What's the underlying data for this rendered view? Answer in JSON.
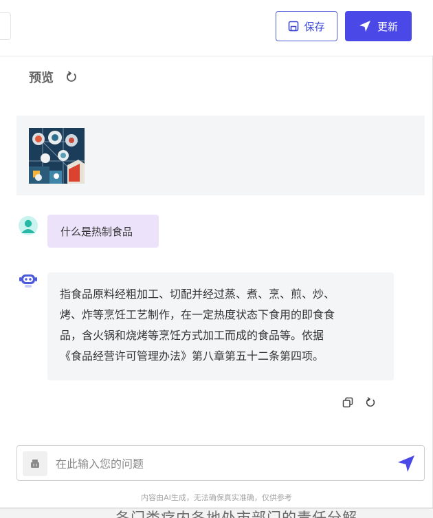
{
  "header": {
    "save_label": "保存",
    "update_label": "更新"
  },
  "preview": {
    "title": "预览"
  },
  "conversation": {
    "user_message": "什么是热制食品",
    "bot_lines": [
      "指食品原料经粗加工、切配并经过蒸、煮、烹、煎、炒、",
      "烤、炸等烹饪工艺制作，在一定热度状态下食用的即食食",
      "品，含火锅和烧烤等烹饪方式加工而成的食品等。依据",
      "《食品经营许可管理办法》第八章第五十二条第四项。"
    ]
  },
  "input": {
    "placeholder": "在此输入您的问题",
    "value": ""
  },
  "footer": {
    "disclaimer": "内容由AI生成，无法确保真实准确，仅供参考"
  },
  "background_page": {
    "text": "各门类疗内各地处市部门的责任分解"
  },
  "colors": {
    "accent": "#4a48e6",
    "user_bubble": "#ece3fb",
    "bot_bubble": "#f4f5f7"
  },
  "icons": {
    "save": "save-icon",
    "update": "send-arrow-icon",
    "refresh": "refresh-icon",
    "copy": "copy-icon",
    "send": "send-icon"
  }
}
